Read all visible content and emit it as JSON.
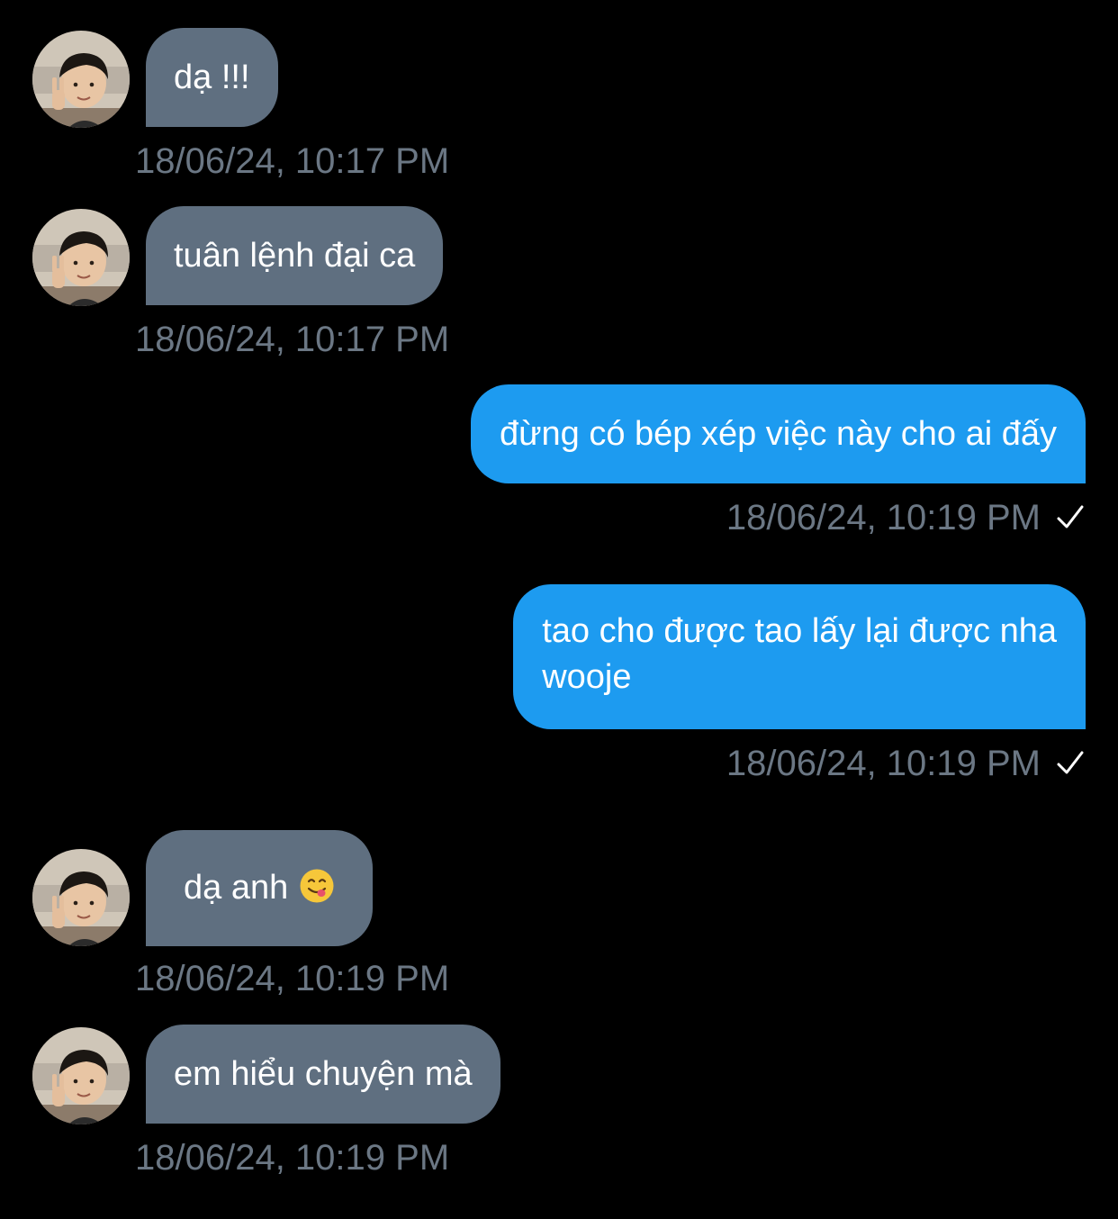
{
  "colors": {
    "background": "#000000",
    "incoming_bubble": "#5f6f80",
    "outgoing_bubble": "#1d9bf0",
    "timestamp": "#6b7784",
    "text": "#ffffff"
  },
  "messages": [
    {
      "direction": "incoming",
      "text": "dạ !!!",
      "timestamp": "18/06/24, 10:17 PM"
    },
    {
      "direction": "incoming",
      "text": "tuân lệnh đại ca",
      "timestamp": "18/06/24, 10:17 PM"
    },
    {
      "direction": "outgoing",
      "text": "đừng có bép xép việc này cho ai đấy",
      "timestamp": "18/06/24, 10:19 PM",
      "status_icon": "check-icon"
    },
    {
      "direction": "outgoing",
      "text_line1": "tao cho được tao lấy lại được nha",
      "text_line2": "wooje",
      "timestamp": "18/06/24, 10:19 PM",
      "status_icon": "check-icon"
    },
    {
      "direction": "incoming",
      "text": "dạ anh",
      "emoji": "yum-face-emoji",
      "timestamp": "18/06/24, 10:19 PM"
    },
    {
      "direction": "incoming",
      "text": "em hiểu chuyện mà",
      "timestamp": "18/06/24, 10:19 PM"
    }
  ]
}
